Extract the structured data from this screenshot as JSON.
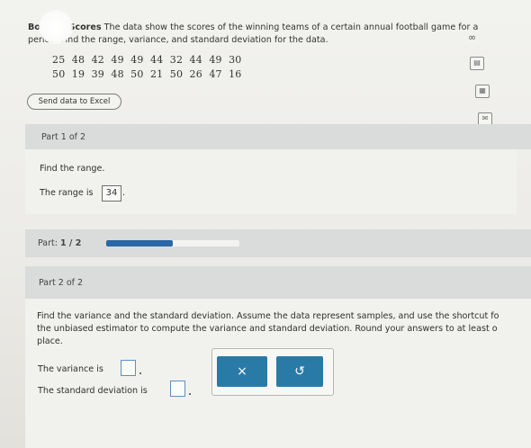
{
  "problem": {
    "title_bold": "Bo      nner Scores",
    "title_rest": " The data show the scores of the winning teams of a certain annual football game for a",
    "title_line2": "period. Find the range, variance, and standard deviation for the data.",
    "data_rows": [
      "25  48  42  49  49  44  32  44  49  30",
      "50  19  39  48  50  21  50  26  47  16"
    ]
  },
  "toolbar": {
    "excel_button_label": "Send data to Excel"
  },
  "part1": {
    "header": "Part 1 of 2",
    "prompt": "Find the range.",
    "range_label": "The range is",
    "range_value": "34",
    "range_suffix": "."
  },
  "progress": {
    "label_prefix": "Part:",
    "label_value": "1 / 2",
    "fraction": 0.5
  },
  "part2": {
    "header": "Part 2 of 2",
    "prompt_line1": "Find the variance and the standard deviation. Assume the data represent samples, and use the shortcut fo",
    "prompt_line2": "the unbiased estimator to compute the variance and standard deviation. Round your answers to at least o",
    "prompt_line3": "place.",
    "variance_label": "The variance is",
    "stddev_label": "The standard deviation is",
    "variance_value": "",
    "stddev_value": ""
  },
  "actions": {
    "clear_symbol": "×",
    "undo_symbol": "↺"
  },
  "colors": {
    "accent": "#2a7aa8",
    "progress": "#2a67a6"
  },
  "icons": [
    "infinity-icon",
    "calculator-icon",
    "expand-icon",
    "mail-icon"
  ]
}
